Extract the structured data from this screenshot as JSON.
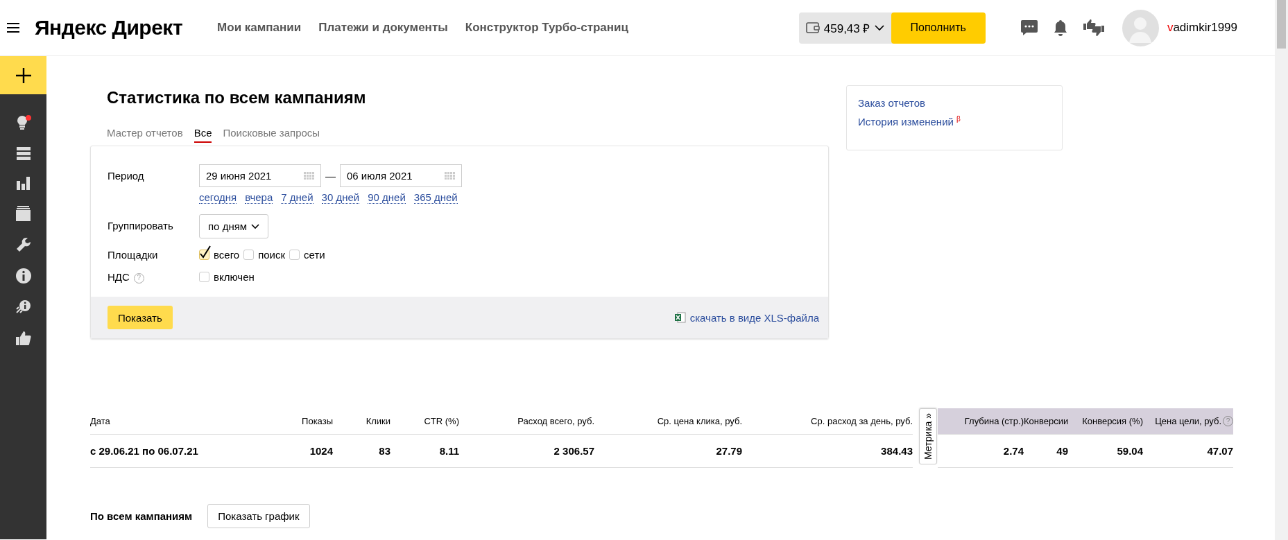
{
  "header": {
    "logo": "Яндекс Директ",
    "nav": [
      {
        "label": "Мои кампании"
      },
      {
        "label": "Платежи и документы"
      },
      {
        "label": "Конструктор Турбо-страниц"
      }
    ],
    "balance": "459,43 ₽",
    "topup_button": "Пополнить",
    "username": "vadimkir1999"
  },
  "sidebar": {
    "notification_dot": true
  },
  "page": {
    "title": "Статистика по всем кампаниям",
    "tabs": [
      {
        "label": "Мастер отчетов",
        "selected": false
      },
      {
        "label": "Все",
        "selected": true
      },
      {
        "label": "Поисковые запросы",
        "selected": false
      }
    ]
  },
  "form": {
    "period": {
      "label": "Период",
      "from": "29 июня 2021",
      "separator": "—",
      "to": "06 июля 2021",
      "presets": [
        "сегодня",
        "вчера",
        "7 дней",
        "30 дней",
        "90 дней",
        "365 дней"
      ]
    },
    "group": {
      "label": "Группировать",
      "value": "по дням"
    },
    "platforms": {
      "label": "Площадки",
      "options": [
        {
          "label": "всего",
          "checked": true
        },
        {
          "label": "поиск",
          "checked": false
        },
        {
          "label": "сети",
          "checked": false
        }
      ]
    },
    "vat": {
      "label": "НДС",
      "help_icon": "?",
      "option": {
        "label": "включен",
        "checked": false
      }
    },
    "submit_button": "Показать",
    "download_link": "скачать в виде XLS-файла"
  },
  "side_links": [
    "Заказ отчетов",
    "История изменений $^{β}$"
  ],
  "table": {
    "metrika_tab": "Метрика »",
    "help_icon": "?",
    "columns": [
      {
        "label": "Дата",
        "kind": "direct"
      },
      {
        "label": "Показы",
        "kind": "direct"
      },
      {
        "label": "Клики",
        "kind": "direct"
      },
      {
        "label": "CTR (%)",
        "kind": "direct"
      },
      {
        "label": "Расход всего, руб.",
        "kind": "direct"
      },
      {
        "label": "Ср. цена клика, руб.",
        "kind": "direct"
      },
      {
        "label": "Ср. расход за день, руб.",
        "kind": "direct"
      },
      {
        "label": "Глубина (стр.)",
        "kind": "metrika"
      },
      {
        "label": "Конверсии",
        "kind": "metrika"
      },
      {
        "label": "Конверсия (%)",
        "kind": "metrika"
      },
      {
        "label": "Цена цели, руб.",
        "kind": "metrika"
      }
    ],
    "rows": [
      [
        "с 29.06.21 по 06.07.21",
        "1024",
        "83",
        "8.11",
        "2 306.57",
        "27.79",
        "384.43",
        "2.74",
        "49",
        "59.04",
        "47.07"
      ]
    ]
  },
  "summary": {
    "label": "По всем кампаниям",
    "chart_button": "Показать график"
  }
}
